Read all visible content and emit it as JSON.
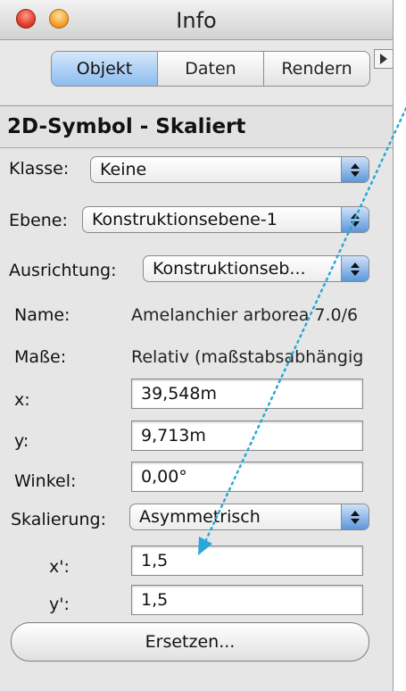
{
  "window": {
    "title": "Info"
  },
  "tabs": [
    {
      "label": "Objekt",
      "active": true
    },
    {
      "label": "Daten",
      "active": false
    },
    {
      "label": "Rendern",
      "active": false
    }
  ],
  "header": {
    "title": "2D-Symbol - Skaliert"
  },
  "fields": {
    "klasse": {
      "label": "Klasse:",
      "value": "Keine"
    },
    "ebene": {
      "label": "Ebene:",
      "value": "Konstruktionsebene-1"
    },
    "ausrichtung": {
      "label": "Ausrichtung:",
      "value": "Konstruktionseb..."
    },
    "name": {
      "label": "Name:",
      "value": "Amelanchier arborea 7.0/6"
    },
    "masse": {
      "label": "Maße:",
      "value": "Relativ (maßstabsabhängig"
    },
    "x": {
      "label": "x:",
      "value": "39,548m"
    },
    "y": {
      "label": "y:",
      "value": "9,713m"
    },
    "winkel": {
      "label": "Winkel:",
      "value": "0,00°"
    },
    "skalierung": {
      "label": "Skalierung:",
      "value": "Asymmetrisch"
    },
    "x_scale": {
      "label": "x':",
      "value": "1,5"
    },
    "y_scale": {
      "label": "y':",
      "value": "1,5"
    }
  },
  "buttons": {
    "replace": "Ersetzen..."
  },
  "colors": {
    "accent_blue": "#5c97db",
    "close_red": "#e2402c",
    "minimize_orange": "#f7a32c",
    "annotation_cyan": "#29a8d8"
  }
}
